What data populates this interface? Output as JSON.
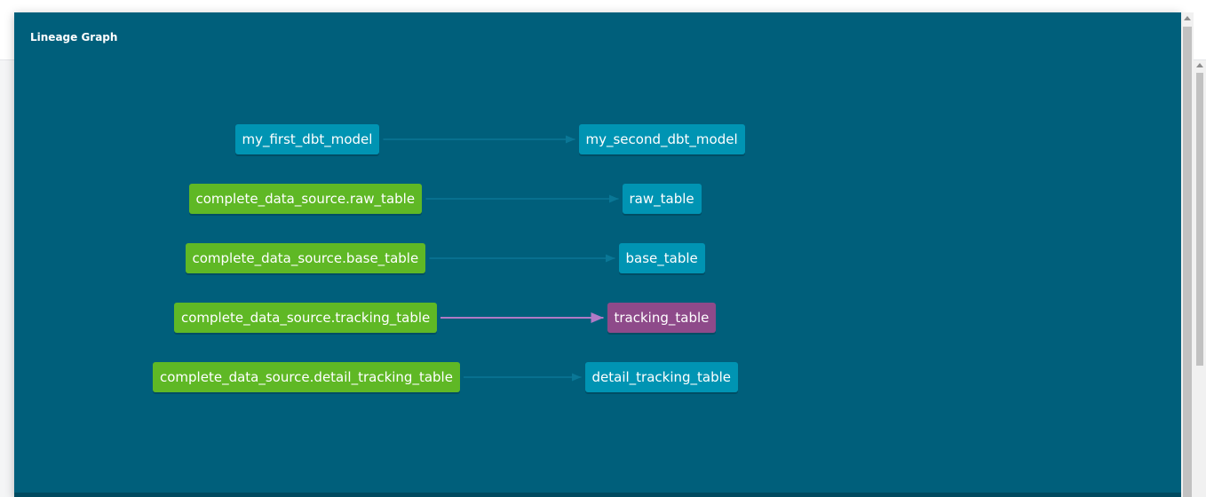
{
  "modal": {
    "title": "Lineage Graph"
  },
  "colors": {
    "background": "#005f7b",
    "model_node": "#0094b3",
    "source_node": "#5fb825",
    "selected_node": "#8e4a8a",
    "edge_default": "#0a7796",
    "edge_highlight": "#b07ac6"
  },
  "graph": {
    "nodes": [
      {
        "id": "n1",
        "label": "my_first_dbt_model",
        "kind": "model"
      },
      {
        "id": "n2",
        "label": "my_second_dbt_model",
        "kind": "model"
      },
      {
        "id": "n3",
        "label": "complete_data_source.raw_table",
        "kind": "source"
      },
      {
        "id": "n4",
        "label": "raw_table",
        "kind": "model"
      },
      {
        "id": "n5",
        "label": "complete_data_source.base_table",
        "kind": "source"
      },
      {
        "id": "n6",
        "label": "base_table",
        "kind": "model"
      },
      {
        "id": "n7",
        "label": "complete_data_source.tracking_table",
        "kind": "source"
      },
      {
        "id": "n8",
        "label": "tracking_table",
        "kind": "selected"
      },
      {
        "id": "n9",
        "label": "complete_data_source.detail_tracking_table",
        "kind": "source"
      },
      {
        "id": "n10",
        "label": "detail_tracking_table",
        "kind": "model"
      }
    ],
    "edges": [
      {
        "from": "n1",
        "to": "n2",
        "highlight": false
      },
      {
        "from": "n3",
        "to": "n4",
        "highlight": false
      },
      {
        "from": "n5",
        "to": "n6",
        "highlight": false
      },
      {
        "from": "n7",
        "to": "n8",
        "highlight": true
      },
      {
        "from": "n9",
        "to": "n10",
        "highlight": false
      }
    ]
  }
}
